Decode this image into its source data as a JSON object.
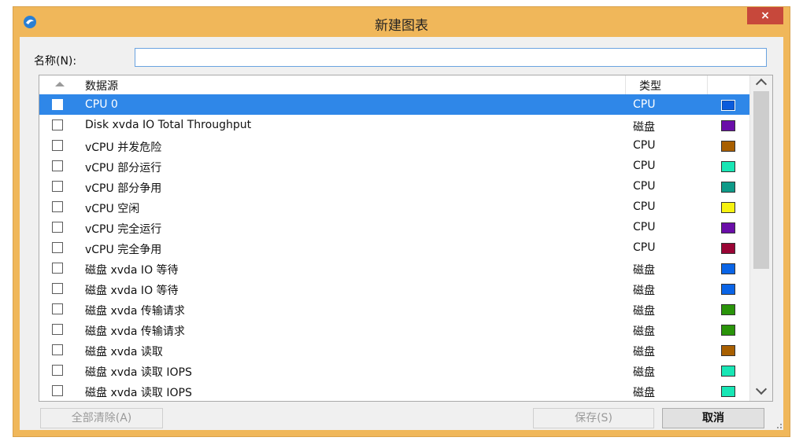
{
  "window": {
    "title": "新建图表",
    "close_label": "×"
  },
  "form": {
    "name_label": "名称(N):",
    "name_value": ""
  },
  "list": {
    "headers": {
      "source": "数据源",
      "type": "类型"
    },
    "rows": [
      {
        "source": "CPU 0",
        "type": "CPU",
        "color": "#0a5bdc",
        "checked": false,
        "selected": true
      },
      {
        "source": "Disk xvda IO Total Throughput",
        "type": "磁盘",
        "color": "#6a0ea8",
        "checked": false
      },
      {
        "source": "vCPU 并发危险",
        "type": "CPU",
        "color": "#a85f00",
        "checked": false
      },
      {
        "source": "vCPU 部分运行",
        "type": "CPU",
        "color": "#18e6b5",
        "checked": false
      },
      {
        "source": "vCPU 部分争用",
        "type": "CPU",
        "color": "#0e9a88",
        "checked": false
      },
      {
        "source": "vCPU 空闲",
        "type": "CPU",
        "color": "#f6f210",
        "checked": false
      },
      {
        "source": "vCPU 完全运行",
        "type": "CPU",
        "color": "#6a0ea8",
        "checked": false
      },
      {
        "source": "vCPU 完全争用",
        "type": "CPU",
        "color": "#9a0535",
        "checked": false
      },
      {
        "source": "磁盘 xvda IO 等待",
        "type": "磁盘",
        "color": "#0a64e6",
        "checked": false
      },
      {
        "source": "磁盘 xvda IO 等待",
        "type": "磁盘",
        "color": "#0a64e6",
        "checked": false
      },
      {
        "source": "磁盘 xvda 传输请求",
        "type": "磁盘",
        "color": "#2a940a",
        "checked": false
      },
      {
        "source": "磁盘 xvda 传输请求",
        "type": "磁盘",
        "color": "#2a940a",
        "checked": false
      },
      {
        "source": "磁盘 xvda 读取",
        "type": "磁盘",
        "color": "#a85f00",
        "checked": false
      },
      {
        "source": "磁盘 xvda 读取 IOPS",
        "type": "磁盘",
        "color": "#18e6b5",
        "checked": false
      },
      {
        "source": "磁盘 xvda 读取 IOPS",
        "type": "磁盘",
        "color": "#18e6b5",
        "checked": false
      }
    ]
  },
  "buttons": {
    "clear_all": "全部清除(A)",
    "save": "保存(S)",
    "cancel": "取消"
  }
}
